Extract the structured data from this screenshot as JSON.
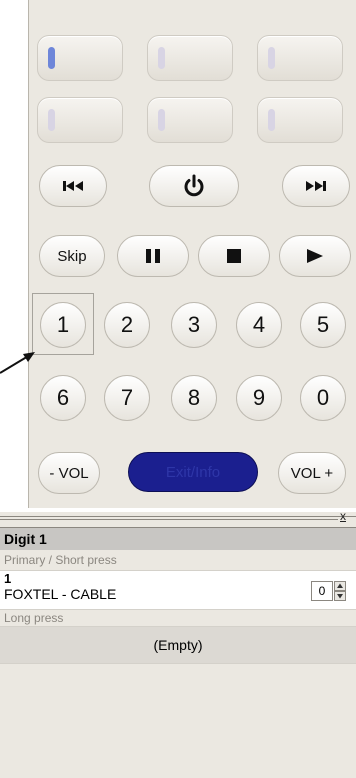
{
  "remote": {
    "transport": {
      "prev_icon": "skip-back-icon",
      "power_icon": "power-icon",
      "next_icon": "skip-forward-icon",
      "skip_label": "Skip",
      "pause_icon": "pause-icon",
      "stop_icon": "stop-icon",
      "play_icon": "play-icon"
    },
    "digits_row1": [
      "1",
      "2",
      "3",
      "4",
      "5"
    ],
    "digits_row2": [
      "6",
      "7",
      "8",
      "9",
      "0"
    ],
    "vol_down_label": "- VOL",
    "vol_up_label": "VOL +",
    "mode_label": "Exit/Info"
  },
  "bottom": {
    "close_icon": "close-icon",
    "close_label": "x",
    "section_title": "Digit 1",
    "primary_label": "Primary / Short press",
    "primary_value": "1",
    "primary_device": "FOXTEL - CABLE",
    "repeat_value": "0",
    "long_press_label": "Long press",
    "long_press_value": "(Empty)"
  },
  "colors": {
    "panel_bg": "#ebe8e1",
    "active_slot": "#6e86d9",
    "mode_button": "#1b1f8f"
  }
}
